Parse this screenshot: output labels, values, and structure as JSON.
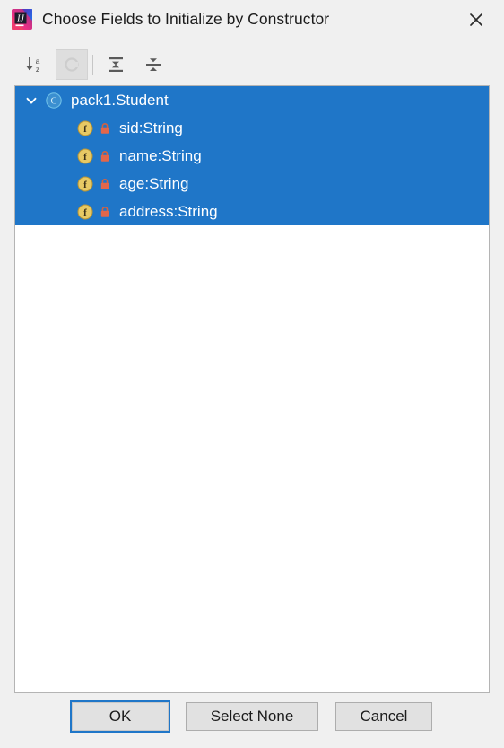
{
  "window": {
    "title": "Choose Fields to Initialize by Constructor",
    "app_icon": "intellij-idea-logo",
    "close_icon": "close-icon"
  },
  "colors": {
    "selection_blue": "#1f76c8",
    "dialog_background": "#f0f0f0",
    "panel_background": "#ffffff",
    "panel_border": "#b4b4b4",
    "class_icon": "#389fd6",
    "field_icon": "#e8c547",
    "lock_icon": "#e2674a",
    "focus_ring": "#1f76c8"
  },
  "toolbar": {
    "buttons": [
      {
        "name": "sort-alphabetically-button",
        "icon": "sort-alphabetically-icon",
        "label": "Sort Alphabetically",
        "enabled": true,
        "pressed": false
      },
      {
        "name": "group-by-class-button",
        "icon": "class-grouping-icon",
        "label": "Group by Class",
        "enabled": false,
        "pressed": true
      },
      {
        "name": "expand-all-button",
        "icon": "expand-all-icon",
        "label": "Expand All",
        "enabled": true,
        "pressed": false
      },
      {
        "name": "collapse-all-button",
        "icon": "collapse-all-icon",
        "label": "Collapse All",
        "enabled": true,
        "pressed": false
      }
    ]
  },
  "tree": {
    "root": {
      "label": "pack1.Student",
      "icon": "class-icon",
      "expanded": true,
      "selected": true,
      "chevron": "chevron-down-icon"
    },
    "fields": [
      {
        "label": "sid:String",
        "icon": "field-icon",
        "modifier_icon": "lock-icon",
        "selected": true
      },
      {
        "label": "name:String",
        "icon": "field-icon",
        "modifier_icon": "lock-icon",
        "selected": true
      },
      {
        "label": "age:String",
        "icon": "field-icon",
        "modifier_icon": "lock-icon",
        "selected": true
      },
      {
        "label": "address:String",
        "icon": "field-icon",
        "modifier_icon": "lock-icon",
        "selected": true
      }
    ]
  },
  "footer": {
    "ok_label": "OK",
    "select_none_label": "Select None",
    "cancel_label": "Cancel"
  }
}
